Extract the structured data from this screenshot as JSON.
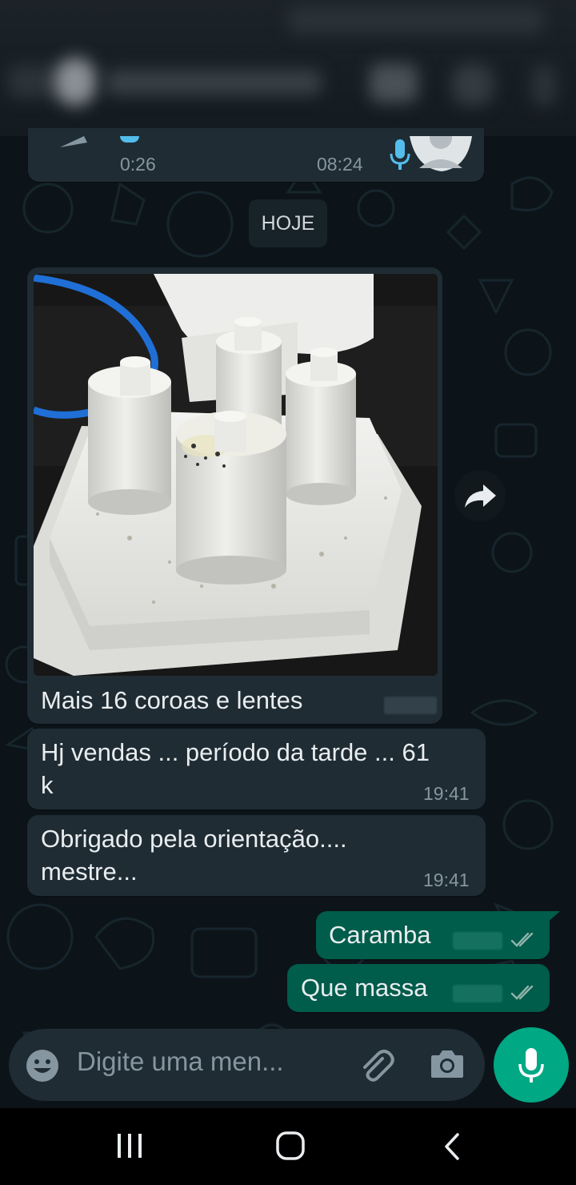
{
  "header": {
    "contact_name": "",
    "status": ""
  },
  "previous_message": {
    "audio_duration": "0:26",
    "time": "08:24"
  },
  "date_chip": "HOJE",
  "messages_in": [
    {
      "text": "Mais 16 coroas e lentes",
      "time": ""
    },
    {
      "line1": "Hj vendas ... período da tarde ... 61",
      "line2": "k",
      "time": "19:41"
    },
    {
      "line1": "Obrigado pela  orientação....",
      "line2": "mestre...",
      "time": "19:41"
    }
  ],
  "messages_out": [
    {
      "text": "Caramba",
      "time": ""
    },
    {
      "text": "Que massa",
      "time": ""
    }
  ],
  "input": {
    "placeholder": "Digite uma men..."
  },
  "icons": {
    "emoji": "emoji-icon",
    "attach": "paperclip-icon",
    "camera": "camera-icon",
    "mic": "microphone-icon",
    "forward": "forward-icon",
    "read_receipt": "double-check-icon"
  },
  "colors": {
    "incoming_bubble": "#1f2c34",
    "outgoing_bubble": "#005c4b",
    "accent": "#00a884",
    "background": "#0b141a",
    "time_text": "#8696a0",
    "mic_in_audio": "#53bdeb"
  }
}
